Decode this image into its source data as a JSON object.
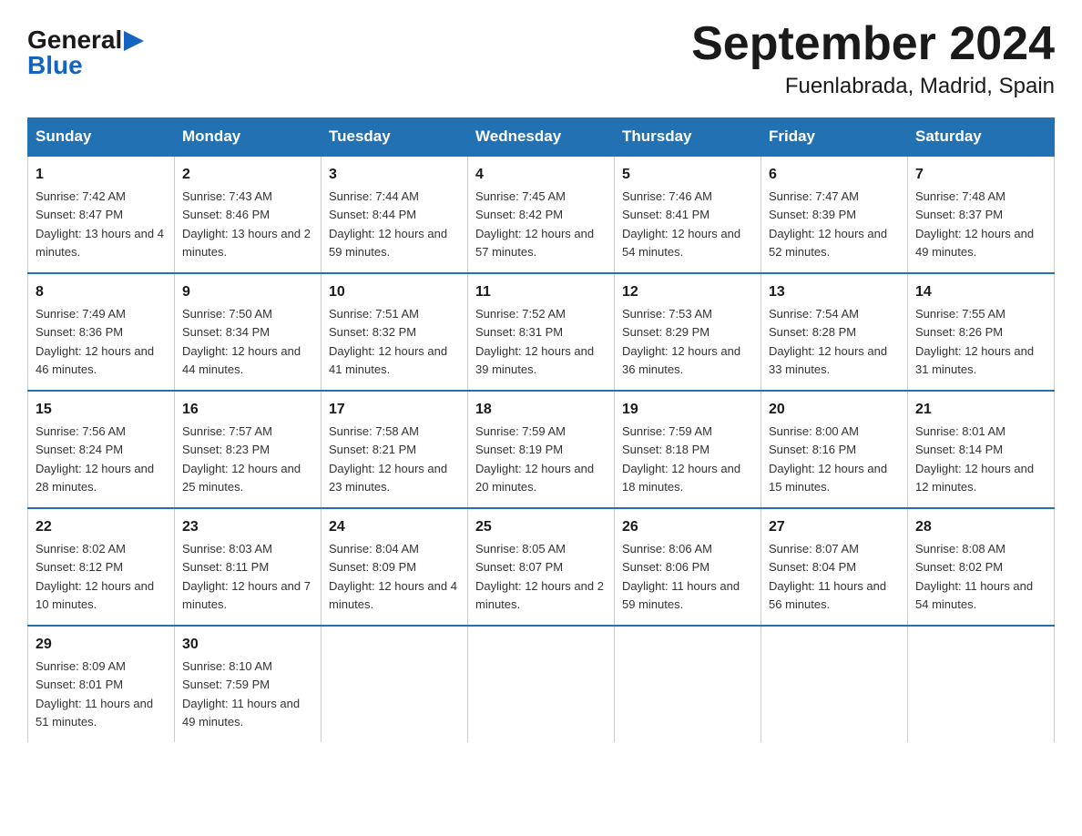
{
  "logo": {
    "general": "General",
    "blue": "Blue",
    "arrow": "▶"
  },
  "title": "September 2024",
  "subtitle": "Fuenlabrada, Madrid, Spain",
  "headers": [
    "Sunday",
    "Monday",
    "Tuesday",
    "Wednesday",
    "Thursday",
    "Friday",
    "Saturday"
  ],
  "weeks": [
    [
      {
        "day": "1",
        "sunrise": "7:42 AM",
        "sunset": "8:47 PM",
        "daylight": "13 hours and 4 minutes."
      },
      {
        "day": "2",
        "sunrise": "7:43 AM",
        "sunset": "8:46 PM",
        "daylight": "13 hours and 2 minutes."
      },
      {
        "day": "3",
        "sunrise": "7:44 AM",
        "sunset": "8:44 PM",
        "daylight": "12 hours and 59 minutes."
      },
      {
        "day": "4",
        "sunrise": "7:45 AM",
        "sunset": "8:42 PM",
        "daylight": "12 hours and 57 minutes."
      },
      {
        "day": "5",
        "sunrise": "7:46 AM",
        "sunset": "8:41 PM",
        "daylight": "12 hours and 54 minutes."
      },
      {
        "day": "6",
        "sunrise": "7:47 AM",
        "sunset": "8:39 PM",
        "daylight": "12 hours and 52 minutes."
      },
      {
        "day": "7",
        "sunrise": "7:48 AM",
        "sunset": "8:37 PM",
        "daylight": "12 hours and 49 minutes."
      }
    ],
    [
      {
        "day": "8",
        "sunrise": "7:49 AM",
        "sunset": "8:36 PM",
        "daylight": "12 hours and 46 minutes."
      },
      {
        "day": "9",
        "sunrise": "7:50 AM",
        "sunset": "8:34 PM",
        "daylight": "12 hours and 44 minutes."
      },
      {
        "day": "10",
        "sunrise": "7:51 AM",
        "sunset": "8:32 PM",
        "daylight": "12 hours and 41 minutes."
      },
      {
        "day": "11",
        "sunrise": "7:52 AM",
        "sunset": "8:31 PM",
        "daylight": "12 hours and 39 minutes."
      },
      {
        "day": "12",
        "sunrise": "7:53 AM",
        "sunset": "8:29 PM",
        "daylight": "12 hours and 36 minutes."
      },
      {
        "day": "13",
        "sunrise": "7:54 AM",
        "sunset": "8:28 PM",
        "daylight": "12 hours and 33 minutes."
      },
      {
        "day": "14",
        "sunrise": "7:55 AM",
        "sunset": "8:26 PM",
        "daylight": "12 hours and 31 minutes."
      }
    ],
    [
      {
        "day": "15",
        "sunrise": "7:56 AM",
        "sunset": "8:24 PM",
        "daylight": "12 hours and 28 minutes."
      },
      {
        "day": "16",
        "sunrise": "7:57 AM",
        "sunset": "8:23 PM",
        "daylight": "12 hours and 25 minutes."
      },
      {
        "day": "17",
        "sunrise": "7:58 AM",
        "sunset": "8:21 PM",
        "daylight": "12 hours and 23 minutes."
      },
      {
        "day": "18",
        "sunrise": "7:59 AM",
        "sunset": "8:19 PM",
        "daylight": "12 hours and 20 minutes."
      },
      {
        "day": "19",
        "sunrise": "7:59 AM",
        "sunset": "8:18 PM",
        "daylight": "12 hours and 18 minutes."
      },
      {
        "day": "20",
        "sunrise": "8:00 AM",
        "sunset": "8:16 PM",
        "daylight": "12 hours and 15 minutes."
      },
      {
        "day": "21",
        "sunrise": "8:01 AM",
        "sunset": "8:14 PM",
        "daylight": "12 hours and 12 minutes."
      }
    ],
    [
      {
        "day": "22",
        "sunrise": "8:02 AM",
        "sunset": "8:12 PM",
        "daylight": "12 hours and 10 minutes."
      },
      {
        "day": "23",
        "sunrise": "8:03 AM",
        "sunset": "8:11 PM",
        "daylight": "12 hours and 7 minutes."
      },
      {
        "day": "24",
        "sunrise": "8:04 AM",
        "sunset": "8:09 PM",
        "daylight": "12 hours and 4 minutes."
      },
      {
        "day": "25",
        "sunrise": "8:05 AM",
        "sunset": "8:07 PM",
        "daylight": "12 hours and 2 minutes."
      },
      {
        "day": "26",
        "sunrise": "8:06 AM",
        "sunset": "8:06 PM",
        "daylight": "11 hours and 59 minutes."
      },
      {
        "day": "27",
        "sunrise": "8:07 AM",
        "sunset": "8:04 PM",
        "daylight": "11 hours and 56 minutes."
      },
      {
        "day": "28",
        "sunrise": "8:08 AM",
        "sunset": "8:02 PM",
        "daylight": "11 hours and 54 minutes."
      }
    ],
    [
      {
        "day": "29",
        "sunrise": "8:09 AM",
        "sunset": "8:01 PM",
        "daylight": "11 hours and 51 minutes."
      },
      {
        "day": "30",
        "sunrise": "8:10 AM",
        "sunset": "7:59 PM",
        "daylight": "11 hours and 49 minutes."
      },
      null,
      null,
      null,
      null,
      null
    ]
  ]
}
